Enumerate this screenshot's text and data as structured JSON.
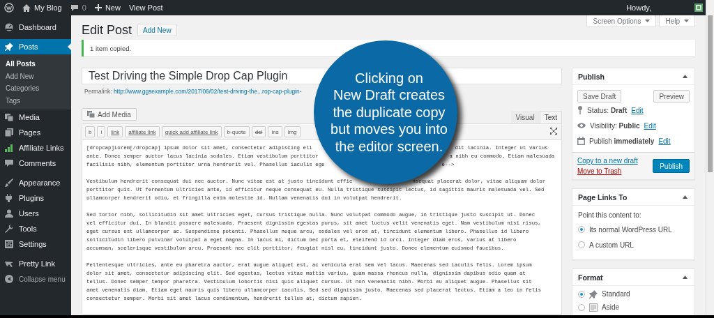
{
  "admin_bar": {
    "site": "My Blog",
    "comments": "0",
    "new": "New",
    "view": "View Post",
    "greeting": "Howdy,"
  },
  "sidebar": {
    "groups": [
      {
        "items": [
          {
            "label": "Dashboard",
            "selected": false
          }
        ]
      },
      {
        "items": [
          {
            "label": "Posts",
            "selected": true,
            "children": [
              {
                "label": "All Posts",
                "selected": true
              },
              {
                "label": "Add New",
                "selected": false
              },
              {
                "label": "Categories",
                "selected": false
              },
              {
                "label": "Tags",
                "selected": false
              }
            ]
          },
          {
            "label": "Media",
            "selected": false
          },
          {
            "label": "Pages",
            "selected": false
          },
          {
            "label": "Affiliate Links",
            "selected": false
          },
          {
            "label": "Comments",
            "selected": false
          }
        ]
      },
      {
        "items": [
          {
            "label": "Appearance",
            "selected": false
          },
          {
            "label": "Plugins",
            "selected": false
          },
          {
            "label": "Users",
            "selected": false
          },
          {
            "label": "Tools",
            "selected": false
          },
          {
            "label": "Settings",
            "selected": false
          }
        ]
      },
      {
        "items": [
          {
            "label": "Pretty Link",
            "selected": false
          }
        ]
      }
    ],
    "collapse": "Collapse menu"
  },
  "screen_meta": [
    "Screen Options",
    "Help"
  ],
  "page": {
    "title": "Edit Post",
    "add_new": "Add New"
  },
  "notice": "1 item copied.",
  "post_title": "Test Driving the Simple Drop Cap Plugin",
  "permalink": {
    "label": "Permalink:",
    "url": "http://www.ggsexample.com/2017/06/02/test-driving-the...rop-cap-plugin-"
  },
  "add_media": "Add Media",
  "editor_tabs": [
    {
      "label": "Visual",
      "selected": false
    },
    {
      "label": "Text",
      "selected": true
    }
  ],
  "quicktags": [
    {
      "label": "b",
      "kind": "bold"
    },
    {
      "label": "i",
      "kind": "italic"
    },
    {
      "label": "link",
      "kind": "underline"
    },
    {
      "label": "affiliate link",
      "kind": "italic-underline"
    },
    {
      "label": "quick add affiliate link",
      "kind": "italic-underline"
    },
    {
      "label": "b-quote",
      "kind": "plain"
    },
    {
      "label": "del",
      "kind": "strike"
    },
    {
      "label": "ins",
      "kind": "plain"
    },
    {
      "label": "img",
      "kind": "plain"
    }
  ],
  "paragraphs": [
    {
      "lines": [
        {
          "text": "[dropcap]Lorem[/dropcap] ipsum dolor sit amet, consectetur adipiscing eli",
          "text_right": "dit lacinia. Integer ut varius"
        },
        {
          "text": "ante. Donec semper auctor lacus lacinia sodales. Etiam vestibulum porttitor",
          "text_right": "a nibh eu commodo. Etiam malesuada"
        },
        {
          "text": "facilisis nibh, elementum porttitor urna hendrerit vel. Phasellus iaculis ege",
          "text_right": "e-->"
        }
      ]
    },
    {
      "lines": [
        {
          "text": "Vestibulum hendrerit consequat dui nec auctor. Nunc vitae est at justo tincidunt effic",
          "text_right": "nsequat placerat dolor, vitae aliquam dolor"
        },
        {
          "text": "porttitor quis. Ut fermentum ultricies ante, id efficitur neque consequat eu. Nulla tristique suscipit lectus, id sagittis mauris malesuada vel. Sed"
        },
        {
          "text": "ullamcorper hendrerit odio, et fringilla enim molestie id. Nullam venenatis dui in volutpat hendrerit."
        }
      ]
    },
    {
      "lines": [
        {
          "text": "Sed tortor nibh, sollicitudin sit amet ultricies eget, cursus tristique nulla. Nunc volutpat commodo augue, in tristique justo suscipit ut. Donec"
        },
        {
          "text": "vel efficitur dui. In blandit posuere malesuada. Praesent dignissim egestas purus, sit amet luctus velit venenatis eget. Nam vestibulum nisi risus,"
        },
        {
          "text": "eget cursus est ullamcorper ac. Suspendisse potenti. Phasellus neque arcu, sodales vel eros at, tincidunt elementum libero. Phasellus id libero"
        },
        {
          "text": "sollicitudin libero pulvinar volutpat a eget magna. In lacus mi, dictum nec porta et, eleifend id orci. Integer diam eros, varius at libero"
        },
        {
          "text": "accumsan, scelerisque vestibulum arcu. Praesent nec elit porttitor, feugiat nisl eu, tincidunt justo. Donec elementum euismod faucibus."
        }
      ]
    },
    {
      "lines": [
        {
          "text": "Pellentesque ultricies, ante eu pharetra auctor, erat augue aliquet est, ac vehicula erat sem vel lacus. Maecenas sed iaculis felis. Lorem ipsum"
        },
        {
          "text": "dolor sit amet, consectetur adipiscing elit. Sed egestas, lectus vitae mattis varius, quam massa rhoncus nulla, dignissim dapibus odio quam at"
        },
        {
          "text": "tellus. Donec semper tempor pharetra. Vestibulum lobortis nisi quis aliquet cursus. Ut non venenatis nibh. Morbi eu aliquet augue. Phasellus sit"
        },
        {
          "text": "amet venenatis diam. Etiam eget mauris quis libero ullamcorper iaculis. Sed sed dignissim justo. Maecenas sed placerat lectus. Etiam a leo in felis"
        },
        {
          "text": "consectetur semper. Morbi sit amet lacus condimentum, hendrerit tellus at, dictum sapien."
        }
      ]
    }
  ],
  "callout": {
    "lines": [
      "Clicking on",
      "New Draft creates",
      "the duplicate copy",
      "but moves you into",
      "the editor screen."
    ]
  },
  "publish_box": {
    "title": "Publish",
    "save_draft": "Save Draft",
    "preview": "Preview",
    "rows": [
      {
        "text": "Status: **Draft**",
        "link": "Edit"
      },
      {
        "text": "Visibility: **Public**",
        "link": "Edit"
      },
      {
        "text": "Publish **immediately**",
        "link": "Edit"
      }
    ],
    "copy_link": "Copy to a new draft",
    "trash_link": "Move to Trash",
    "publish_button": "Publish"
  },
  "page_links_box": {
    "title": "Page Links To",
    "prompt": "Point this content to:",
    "options": [
      {
        "label": "Its normal WordPress URL",
        "selected": true
      },
      {
        "label": "A custom URL",
        "selected": false
      }
    ]
  },
  "format_box": {
    "title": "Format",
    "options": [
      {
        "label": "Standard",
        "selected": true
      },
      {
        "label": "Aside",
        "selected": false
      }
    ]
  }
}
